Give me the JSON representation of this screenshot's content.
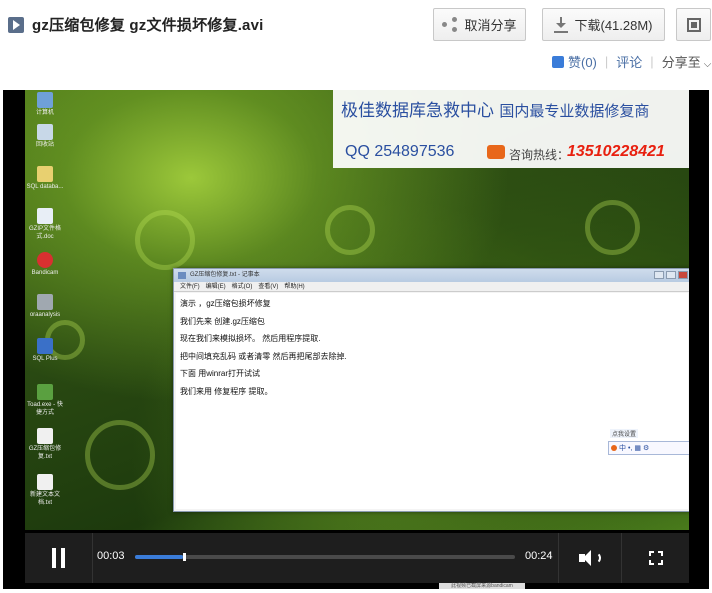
{
  "header": {
    "title": "gz压缩包修复  gz文件损坏修复.avi",
    "cancel_share_label": "取消分享",
    "download_label": "下载(41.28M)",
    "like_label": "赞(0)",
    "comment_label": "评论",
    "share_to_label": "分享至"
  },
  "desktop": {
    "icons": [
      "计算机",
      "回收站",
      "SQL databa...",
      "GZIP文件格式.doc",
      "Bandicam",
      "oraanalysis",
      "SQL Plus",
      "Toad.exe - 快捷方式",
      "GZ压缩包修复.txt",
      "新建文本文档.txt"
    ]
  },
  "banner": {
    "line1_main": "极佳数据库急救中心",
    "line1_sub": "国内最专业数据修复商",
    "qq": "QQ 254897536",
    "hotline_label": "咨询热线：",
    "hotline_number": "13510228421"
  },
  "notepad": {
    "title": "GZ压缩包修复.txt - 记事本",
    "menu": [
      "文件(F)",
      "编辑(E)",
      "格式(O)",
      "查看(V)",
      "帮助(H)"
    ],
    "lines": [
      "演示 ，gz压缩包损坏修复",
      "我们先来 创建.gz压缩包",
      "现在我们来模拟损坏。 然后用程序提取.",
      "把中间填充乱码 或者清零 然后再把尾部去除掉.",
      "下面 用winrar打开试试",
      "我们来用 修复程序 提取。"
    ]
  },
  "ime": {
    "title": "点我设置",
    "mode": "中"
  },
  "player": {
    "current_time": "00:03",
    "duration": "00:24",
    "progress_fraction": 0.125,
    "caption": "此视频已截屏来源bandicam"
  },
  "colors": {
    "accent": "#3a7cd9",
    "hotline": "#e8200f",
    "banner_text": "#2a4fa0"
  }
}
